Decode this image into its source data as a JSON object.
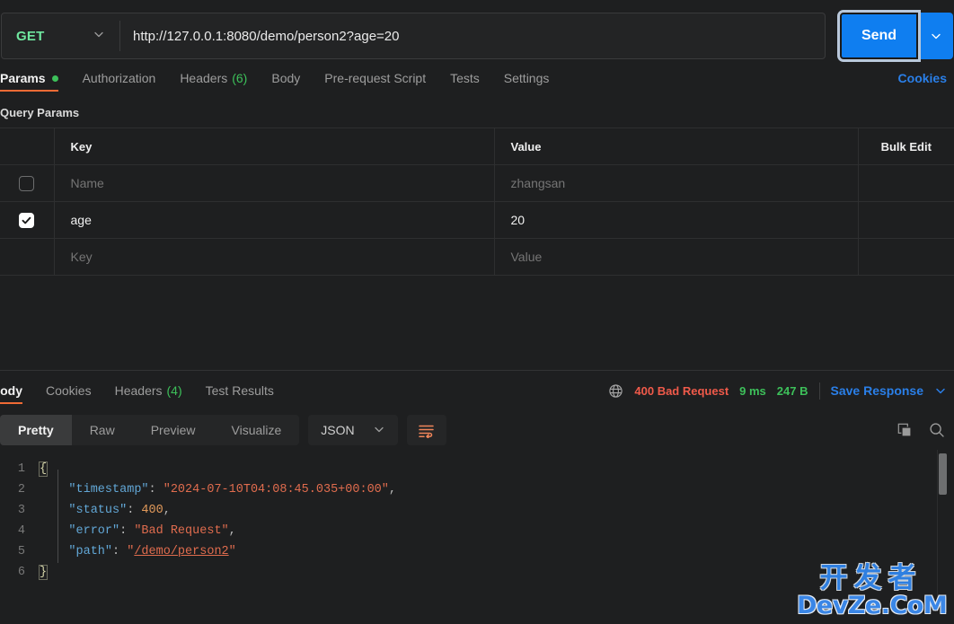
{
  "request": {
    "method": "GET",
    "method_caret_icon": "chevron-down-icon",
    "url": "http://127.0.0.1:8080/demo/person2?age=20",
    "send_label": "Send",
    "send_caret_icon": "chevron-down-icon",
    "tabs": [
      {
        "label": "Params",
        "dot": true,
        "active": true
      },
      {
        "label": "Authorization",
        "active": false
      },
      {
        "label": "Headers",
        "count": "(6)",
        "active": false
      },
      {
        "label": "Body",
        "active": false
      },
      {
        "label": "Pre-request Script",
        "active": false
      },
      {
        "label": "Tests",
        "active": false
      },
      {
        "label": "Settings",
        "active": false
      }
    ],
    "cookies_link": "Cookies"
  },
  "query_params": {
    "section_title": "Query Params",
    "headers": {
      "key": "Key",
      "value": "Value",
      "bulk_edit": "Bulk Edit"
    },
    "rows": [
      {
        "checked": false,
        "key": "Name",
        "key_is_placeholder": true,
        "value": "zhangsan",
        "value_is_placeholder": true
      },
      {
        "checked": true,
        "key": "age",
        "key_is_placeholder": false,
        "value": "20",
        "value_is_placeholder": false
      },
      {
        "checked": null,
        "key": "Key",
        "key_is_placeholder": true,
        "value": "Value",
        "value_is_placeholder": true
      }
    ]
  },
  "response": {
    "tabs": [
      {
        "label": "Body",
        "active": true
      },
      {
        "label": "Cookies",
        "active": false
      },
      {
        "label": "Headers",
        "count": "(4)",
        "active": false
      },
      {
        "label": "Test Results",
        "active": false
      }
    ],
    "globe_icon": "globe-icon",
    "status": "400 Bad Request",
    "time": "9 ms",
    "size": "247 B",
    "save_response": "Save Response",
    "save_caret_icon": "chevron-down-icon",
    "view_modes": [
      "Pretty",
      "Raw",
      "Preview",
      "Visualize"
    ],
    "active_view_mode": "Pretty",
    "format": "JSON",
    "format_caret_icon": "chevron-down-icon",
    "wrap_icon": "word-wrap-icon",
    "copy_icon": "copy-icon",
    "search_icon": "search-icon",
    "body_lines": [
      {
        "n": "1",
        "tokens": [
          {
            "t": "brace",
            "v": "{"
          }
        ]
      },
      {
        "n": "2",
        "tokens": [
          {
            "t": "plain",
            "v": "    "
          },
          {
            "t": "key",
            "v": "\"timestamp\""
          },
          {
            "t": "punc",
            "v": ": "
          },
          {
            "t": "str",
            "v": "\"2024-07-10T04:08:45.035+00:00\""
          },
          {
            "t": "punc",
            "v": ","
          }
        ]
      },
      {
        "n": "3",
        "tokens": [
          {
            "t": "plain",
            "v": "    "
          },
          {
            "t": "key",
            "v": "\"status\""
          },
          {
            "t": "punc",
            "v": ": "
          },
          {
            "t": "num",
            "v": "400"
          },
          {
            "t": "punc",
            "v": ","
          }
        ]
      },
      {
        "n": "4",
        "tokens": [
          {
            "t": "plain",
            "v": "    "
          },
          {
            "t": "key",
            "v": "\"error\""
          },
          {
            "t": "punc",
            "v": ": "
          },
          {
            "t": "str",
            "v": "\"Bad Request\""
          },
          {
            "t": "punc",
            "v": ","
          }
        ]
      },
      {
        "n": "5",
        "tokens": [
          {
            "t": "plain",
            "v": "    "
          },
          {
            "t": "key",
            "v": "\"path\""
          },
          {
            "t": "punc",
            "v": ": "
          },
          {
            "t": "str",
            "v": "\""
          },
          {
            "t": "link",
            "v": "/demo/person2"
          },
          {
            "t": "str",
            "v": "\""
          }
        ]
      },
      {
        "n": "6",
        "tokens": [
          {
            "t": "brace",
            "v": "}"
          }
        ]
      }
    ]
  },
  "watermark": {
    "cn": "开发者",
    "en": "DevZe.CoM"
  },
  "colors": {
    "accent_orange": "#f06a35",
    "link_blue": "#2a7fe8",
    "send_blue": "#0f7ef0",
    "green": "#3dc05a",
    "method_green": "#6fe79f",
    "error_red": "#f05a4a",
    "bg": "#1e1f20"
  }
}
